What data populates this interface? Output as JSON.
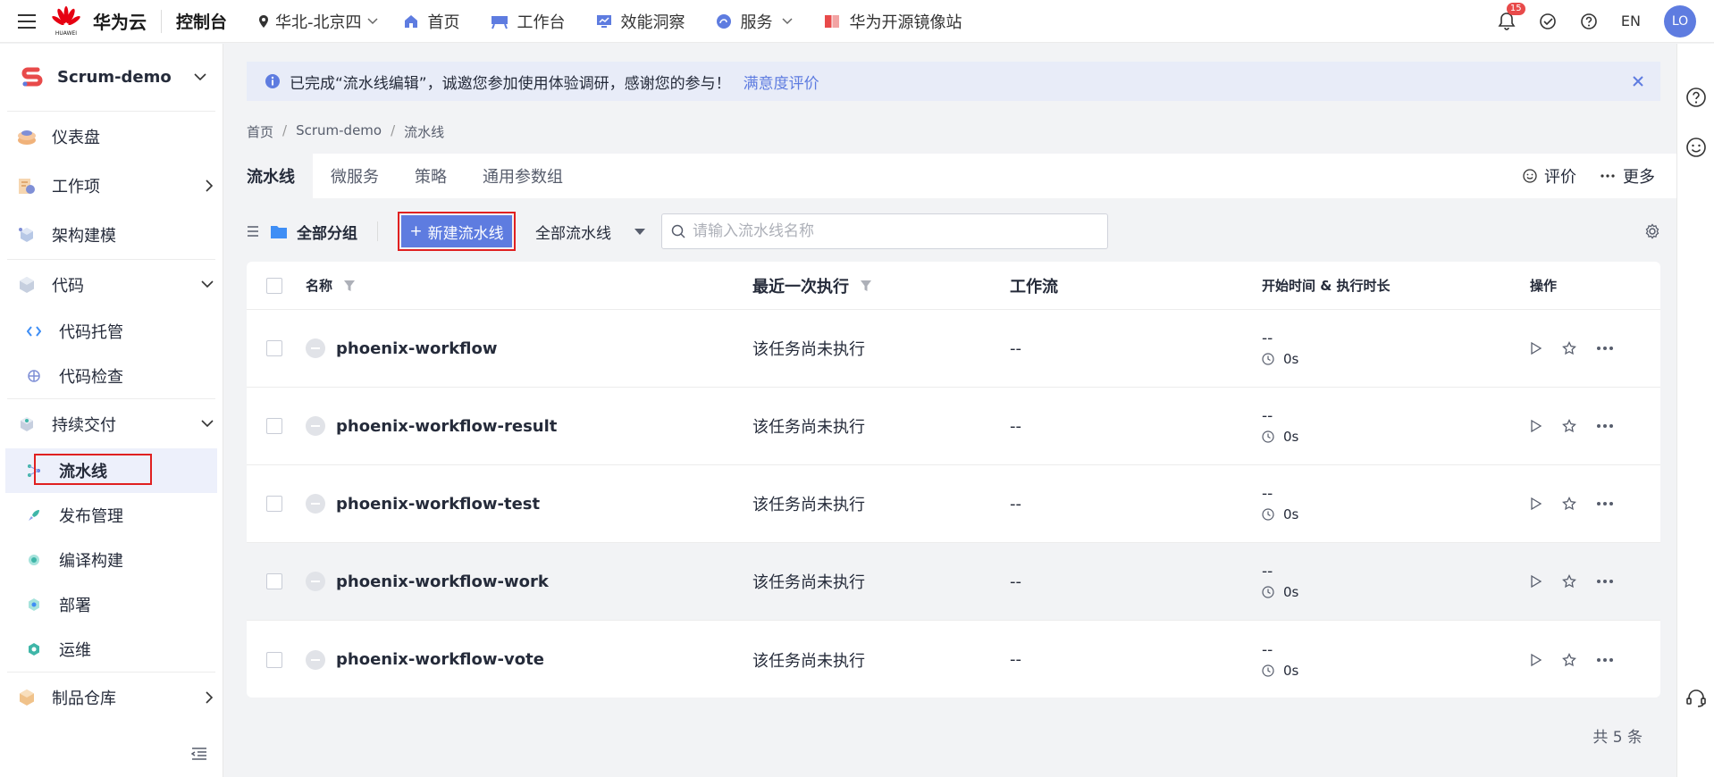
{
  "brand": {
    "logo_caption": "HUAWEI",
    "name": "华为云",
    "console": "控制台"
  },
  "region": "华北-北京四",
  "topnav": [
    {
      "label": "首页"
    },
    {
      "label": "工作台"
    },
    {
      "label": "效能洞察"
    },
    {
      "label": "服务"
    },
    {
      "label": "华为开源镜像站"
    }
  ],
  "top_right": {
    "notification_count": "15",
    "lang": "EN",
    "avatar": "LO"
  },
  "sidebar": {
    "project": "Scrum-demo",
    "items": [
      {
        "label": "仪表盘"
      },
      {
        "label": "工作项"
      },
      {
        "label": "架构建模"
      },
      {
        "label": "代码"
      },
      {
        "label": "代码托管"
      },
      {
        "label": "代码检查"
      },
      {
        "label": "持续交付"
      },
      {
        "label": "流水线"
      },
      {
        "label": "发布管理"
      },
      {
        "label": "编译构建"
      },
      {
        "label": "部署"
      },
      {
        "label": "运维"
      },
      {
        "label": "制品仓库"
      }
    ]
  },
  "notice": {
    "text": "已完成“流水线编辑”，诚邀您参加使用体验调研，感谢您的参与！",
    "link": "满意度评价"
  },
  "breadcrumb": [
    "首页",
    "Scrum-demo",
    "流水线"
  ],
  "tabs": [
    "流水线",
    "微服务",
    "策略",
    "通用参数组"
  ],
  "tabs_right": {
    "rate": "评价",
    "more": "更多"
  },
  "toolbar": {
    "group": "全部分组",
    "new_button": "新建流水线",
    "filter": "全部流水线",
    "search_placeholder": "请输入流水线名称"
  },
  "table": {
    "headers": [
      "名称",
      "最近一次执行",
      "工作流",
      "开始时间 & 执行时长",
      "操作"
    ],
    "rows": [
      {
        "name": "phoenix-workflow",
        "last": "该任务尚未执行",
        "flow": "--",
        "start": "--",
        "duration": "0s"
      },
      {
        "name": "phoenix-workflow-result",
        "last": "该任务尚未执行",
        "flow": "--",
        "start": "--",
        "duration": "0s"
      },
      {
        "name": "phoenix-workflow-test",
        "last": "该任务尚未执行",
        "flow": "--",
        "start": "--",
        "duration": "0s"
      },
      {
        "name": "phoenix-workflow-work",
        "last": "该任务尚未执行",
        "flow": "--",
        "start": "--",
        "duration": "0s"
      },
      {
        "name": "phoenix-workflow-vote",
        "last": "该任务尚未执行",
        "flow": "--",
        "start": "--",
        "duration": "0s"
      }
    ]
  },
  "total": "共 5 条",
  "colors": {
    "accent": "#5e7ce0",
    "highlight_border": "#e02020",
    "notice_bg": "#e8ecf8"
  }
}
